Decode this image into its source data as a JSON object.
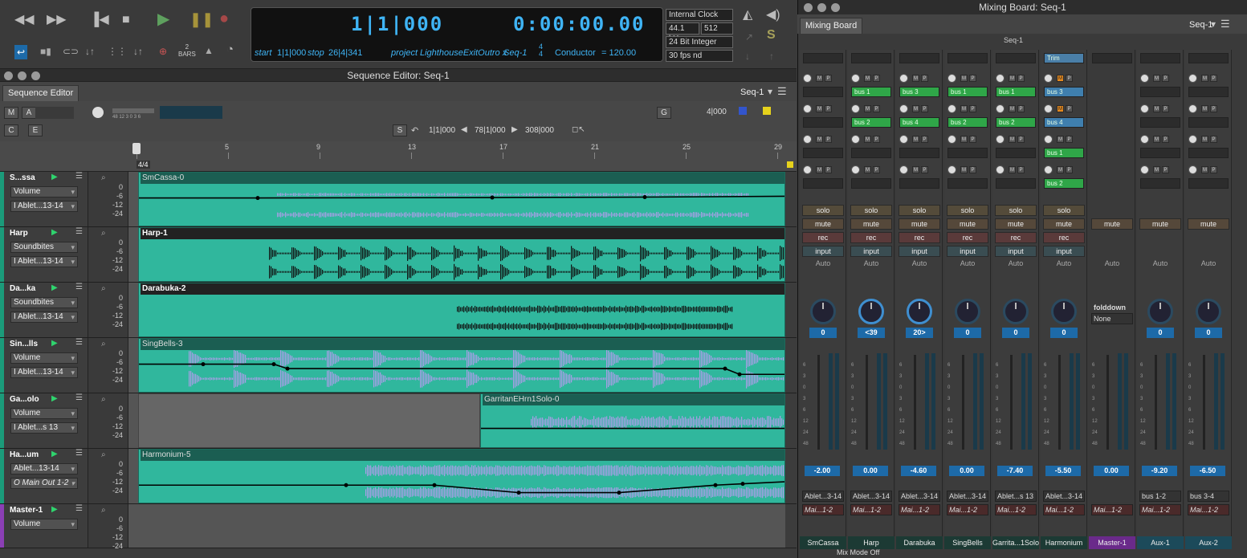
{
  "transport": {
    "bars_label": "BARS",
    "bars_num": "2",
    "counter_main": "1|1|000",
    "counter_time": "0:00:00.00",
    "start_label": "start",
    "start_val": "1|1|000",
    "stop_label": "stop",
    "stop_val": "26|4|341",
    "project_label": "project",
    "project_name": "LighthouseExitOutro x",
    "seq_name": "Seq-1",
    "meter_top": "4",
    "meter_bot": "4",
    "conductor": "Conductor",
    "tempo": "= 120.00",
    "clock": "Internal Clock",
    "rate": "44.1 kHz",
    "buffer": "512",
    "bitdepth": "24 Bit Integer",
    "fps": "30 fps nd"
  },
  "seq": {
    "title": "Sequence Editor: Seq-1",
    "tab": "Sequence Editor",
    "seq_menu": "Seq-1",
    "btn_m": "M",
    "btn_a": "A",
    "btn_c": "C",
    "btn_e": "E",
    "btn_g": "G",
    "btn_s": "S",
    "zoom_vals": "48 12 3 0 3 6",
    "loc_start": "1|1|000",
    "loc_end": "78|1|000",
    "loc_len": "308|000",
    "grid_val": "4|000",
    "meter_marker": "4/4",
    "ruler": [
      "1",
      "5",
      "9",
      "13",
      "17",
      "21",
      "25",
      "29"
    ],
    "scale": [
      "0",
      "-6",
      "-12",
      "-24"
    ]
  },
  "tracks": [
    {
      "name": "S...ssa",
      "plugin": "Volume",
      "input": "I  Ablet...13-14",
      "region": "SmCassa-0"
    },
    {
      "name": "Harp",
      "plugin": "Soundbites",
      "input": "I  Ablet...13-14",
      "region": "Harp-1"
    },
    {
      "name": "Da...ka",
      "plugin": "Soundbites",
      "input": "I  Ablet...13-14",
      "region": "Darabuka-2"
    },
    {
      "name": "Sin...lls",
      "plugin": "Volume",
      "input": "I  Ablet...13-14",
      "region": "SingBells-3"
    },
    {
      "name": "Ga...olo",
      "plugin": "Volume",
      "input": "I  Ablet...s 13",
      "region": "GarritanEHrn1Solo-0"
    },
    {
      "name": "Ha...um",
      "plugin": "Ablet...13-14",
      "input": "O  Main Out 1-2",
      "region": "Harmonium-5"
    },
    {
      "name": "Master-1",
      "plugin": "Volume",
      "input": "",
      "region": ""
    }
  ],
  "mixer": {
    "title": "Mixing Board: Seq-1",
    "tab": "Mixing Board",
    "seq_menu": "Seq-1",
    "seq_label": "Seq-1",
    "trim": "Trim",
    "foldown": "folddown",
    "foldown_val": "None",
    "auto": "Auto",
    "solo": "solo",
    "mute": "mute",
    "rec": "rec",
    "input": "input",
    "mode": "Mix Mode Off",
    "channels": [
      {
        "name": "SmCassa",
        "pan": "0",
        "fader": "-2.00",
        "in": "Ablet...3-14",
        "out": "Mai...1-2",
        "sends": [
          "",
          "",
          "",
          ""
        ]
      },
      {
        "name": "Harp",
        "pan": "<39",
        "fader": "0.00",
        "in": "Ablet...3-14",
        "out": "Mai...1-2",
        "sends": [
          "bus 1",
          "bus 2",
          "",
          ""
        ]
      },
      {
        "name": "Darabuka",
        "pan": "20>",
        "fader": "-4.60",
        "in": "Ablet...3-14",
        "out": "Mai...1-2",
        "sends": [
          "bus 3",
          "bus 4",
          "",
          ""
        ]
      },
      {
        "name": "SingBells",
        "pan": "0",
        "fader": "0.00",
        "in": "Ablet...3-14",
        "out": "Mai...1-2",
        "sends": [
          "bus 1",
          "bus 2",
          "",
          ""
        ]
      },
      {
        "name": "Garrita...1Solo",
        "pan": "0",
        "fader": "-7.40",
        "in": "Ablet...s 13",
        "out": "Mai...1-2",
        "sends": [
          "bus 1",
          "bus 2",
          "",
          ""
        ]
      },
      {
        "name": "Harmonium",
        "pan": "0",
        "fader": "-5.50",
        "in": "Ablet...3-14",
        "out": "Mai...1-2",
        "sends": [
          "bus 3",
          "bus 4",
          "bus 1",
          "bus 2"
        ]
      },
      {
        "name": "Master-1",
        "pan": "",
        "fader": "0.00",
        "in": "",
        "out": "Mai...1-2",
        "sends": [
          "",
          "",
          "",
          ""
        ]
      },
      {
        "name": "Aux-1",
        "pan": "0",
        "fader": "-9.20",
        "in": "bus 1-2",
        "out": "Mai...1-2",
        "sends": [
          "",
          "",
          "",
          ""
        ]
      },
      {
        "name": "Aux-2",
        "pan": "0",
        "fader": "-6.50",
        "in": "bus 3-4",
        "out": "Mai...1-2",
        "sends": [
          "",
          "",
          "",
          ""
        ]
      }
    ],
    "meter_scale": [
      "6",
      "3",
      "0",
      "3",
      "6",
      "12",
      "24",
      "48"
    ]
  }
}
